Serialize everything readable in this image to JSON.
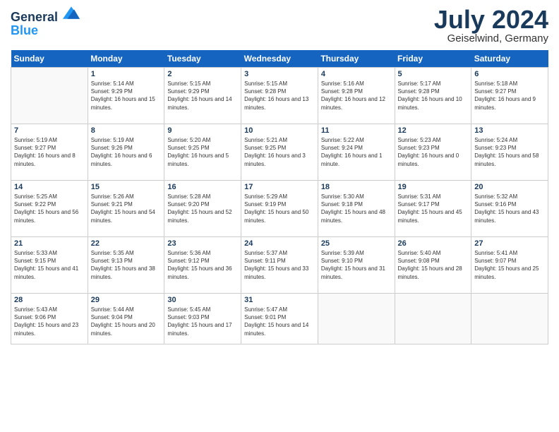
{
  "header": {
    "logo_line1": "General",
    "logo_line2": "Blue",
    "month": "July 2024",
    "location": "Geiselwind, Germany"
  },
  "weekdays": [
    "Sunday",
    "Monday",
    "Tuesday",
    "Wednesday",
    "Thursday",
    "Friday",
    "Saturday"
  ],
  "weeks": [
    [
      {
        "day": "",
        "empty": true
      },
      {
        "day": "1",
        "sunrise": "Sunrise: 5:14 AM",
        "sunset": "Sunset: 9:29 PM",
        "daylight": "Daylight: 16 hours and 15 minutes."
      },
      {
        "day": "2",
        "sunrise": "Sunrise: 5:15 AM",
        "sunset": "Sunset: 9:29 PM",
        "daylight": "Daylight: 16 hours and 14 minutes."
      },
      {
        "day": "3",
        "sunrise": "Sunrise: 5:15 AM",
        "sunset": "Sunset: 9:28 PM",
        "daylight": "Daylight: 16 hours and 13 minutes."
      },
      {
        "day": "4",
        "sunrise": "Sunrise: 5:16 AM",
        "sunset": "Sunset: 9:28 PM",
        "daylight": "Daylight: 16 hours and 12 minutes."
      },
      {
        "day": "5",
        "sunrise": "Sunrise: 5:17 AM",
        "sunset": "Sunset: 9:28 PM",
        "daylight": "Daylight: 16 hours and 10 minutes."
      },
      {
        "day": "6",
        "sunrise": "Sunrise: 5:18 AM",
        "sunset": "Sunset: 9:27 PM",
        "daylight": "Daylight: 16 hours and 9 minutes."
      }
    ],
    [
      {
        "day": "7",
        "sunrise": "Sunrise: 5:19 AM",
        "sunset": "Sunset: 9:27 PM",
        "daylight": "Daylight: 16 hours and 8 minutes."
      },
      {
        "day": "8",
        "sunrise": "Sunrise: 5:19 AM",
        "sunset": "Sunset: 9:26 PM",
        "daylight": "Daylight: 16 hours and 6 minutes."
      },
      {
        "day": "9",
        "sunrise": "Sunrise: 5:20 AM",
        "sunset": "Sunset: 9:25 PM",
        "daylight": "Daylight: 16 hours and 5 minutes."
      },
      {
        "day": "10",
        "sunrise": "Sunrise: 5:21 AM",
        "sunset": "Sunset: 9:25 PM",
        "daylight": "Daylight: 16 hours and 3 minutes."
      },
      {
        "day": "11",
        "sunrise": "Sunrise: 5:22 AM",
        "sunset": "Sunset: 9:24 PM",
        "daylight": "Daylight: 16 hours and 1 minute."
      },
      {
        "day": "12",
        "sunrise": "Sunrise: 5:23 AM",
        "sunset": "Sunset: 9:23 PM",
        "daylight": "Daylight: 16 hours and 0 minutes."
      },
      {
        "day": "13",
        "sunrise": "Sunrise: 5:24 AM",
        "sunset": "Sunset: 9:23 PM",
        "daylight": "Daylight: 15 hours and 58 minutes."
      }
    ],
    [
      {
        "day": "14",
        "sunrise": "Sunrise: 5:25 AM",
        "sunset": "Sunset: 9:22 PM",
        "daylight": "Daylight: 15 hours and 56 minutes."
      },
      {
        "day": "15",
        "sunrise": "Sunrise: 5:26 AM",
        "sunset": "Sunset: 9:21 PM",
        "daylight": "Daylight: 15 hours and 54 minutes."
      },
      {
        "day": "16",
        "sunrise": "Sunrise: 5:28 AM",
        "sunset": "Sunset: 9:20 PM",
        "daylight": "Daylight: 15 hours and 52 minutes."
      },
      {
        "day": "17",
        "sunrise": "Sunrise: 5:29 AM",
        "sunset": "Sunset: 9:19 PM",
        "daylight": "Daylight: 15 hours and 50 minutes."
      },
      {
        "day": "18",
        "sunrise": "Sunrise: 5:30 AM",
        "sunset": "Sunset: 9:18 PM",
        "daylight": "Daylight: 15 hours and 48 minutes."
      },
      {
        "day": "19",
        "sunrise": "Sunrise: 5:31 AM",
        "sunset": "Sunset: 9:17 PM",
        "daylight": "Daylight: 15 hours and 45 minutes."
      },
      {
        "day": "20",
        "sunrise": "Sunrise: 5:32 AM",
        "sunset": "Sunset: 9:16 PM",
        "daylight": "Daylight: 15 hours and 43 minutes."
      }
    ],
    [
      {
        "day": "21",
        "sunrise": "Sunrise: 5:33 AM",
        "sunset": "Sunset: 9:15 PM",
        "daylight": "Daylight: 15 hours and 41 minutes."
      },
      {
        "day": "22",
        "sunrise": "Sunrise: 5:35 AM",
        "sunset": "Sunset: 9:13 PM",
        "daylight": "Daylight: 15 hours and 38 minutes."
      },
      {
        "day": "23",
        "sunrise": "Sunrise: 5:36 AM",
        "sunset": "Sunset: 9:12 PM",
        "daylight": "Daylight: 15 hours and 36 minutes."
      },
      {
        "day": "24",
        "sunrise": "Sunrise: 5:37 AM",
        "sunset": "Sunset: 9:11 PM",
        "daylight": "Daylight: 15 hours and 33 minutes."
      },
      {
        "day": "25",
        "sunrise": "Sunrise: 5:39 AM",
        "sunset": "Sunset: 9:10 PM",
        "daylight": "Daylight: 15 hours and 31 minutes."
      },
      {
        "day": "26",
        "sunrise": "Sunrise: 5:40 AM",
        "sunset": "Sunset: 9:08 PM",
        "daylight": "Daylight: 15 hours and 28 minutes."
      },
      {
        "day": "27",
        "sunrise": "Sunrise: 5:41 AM",
        "sunset": "Sunset: 9:07 PM",
        "daylight": "Daylight: 15 hours and 25 minutes."
      }
    ],
    [
      {
        "day": "28",
        "sunrise": "Sunrise: 5:43 AM",
        "sunset": "Sunset: 9:06 PM",
        "daylight": "Daylight: 15 hours and 23 minutes."
      },
      {
        "day": "29",
        "sunrise": "Sunrise: 5:44 AM",
        "sunset": "Sunset: 9:04 PM",
        "daylight": "Daylight: 15 hours and 20 minutes."
      },
      {
        "day": "30",
        "sunrise": "Sunrise: 5:45 AM",
        "sunset": "Sunset: 9:03 PM",
        "daylight": "Daylight: 15 hours and 17 minutes."
      },
      {
        "day": "31",
        "sunrise": "Sunrise: 5:47 AM",
        "sunset": "Sunset: 9:01 PM",
        "daylight": "Daylight: 15 hours and 14 minutes."
      },
      {
        "day": "",
        "empty": true
      },
      {
        "day": "",
        "empty": true
      },
      {
        "day": "",
        "empty": true
      }
    ]
  ]
}
